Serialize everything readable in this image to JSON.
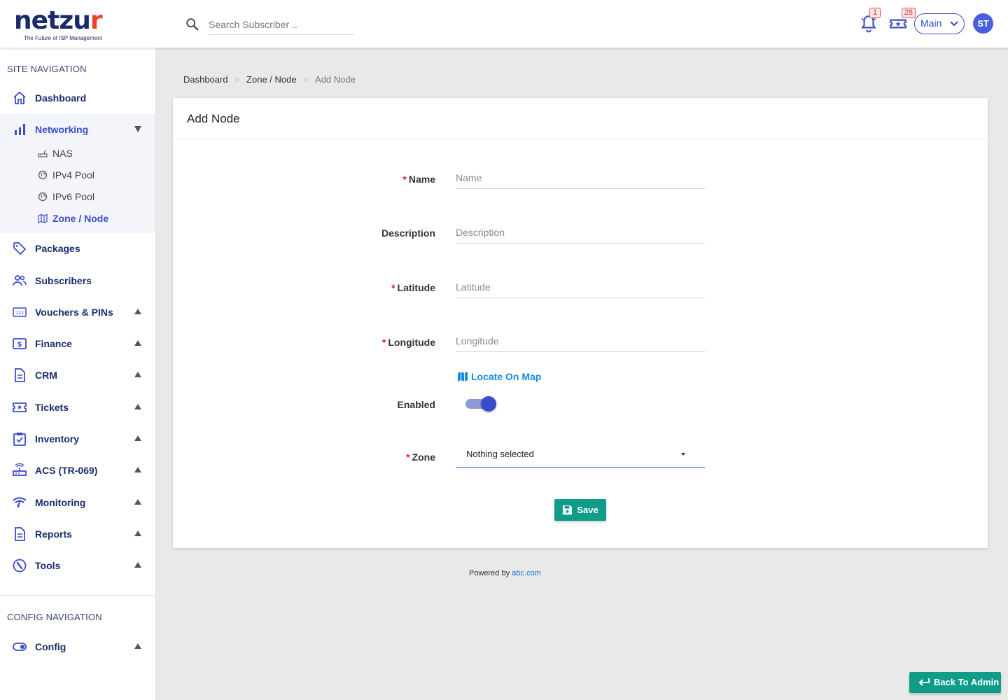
{
  "header": {
    "logo_text": "netzur",
    "logo_tagline": "The Future of ISP Management",
    "search_placeholder": "Search Subscriber ..",
    "notifications_count": "1",
    "tickets_count": "28",
    "account_label": "Main",
    "avatar_initials": "ST"
  },
  "sidebar": {
    "site_nav_title": "SITE NAVIGATION",
    "config_nav_title": "CONFIG NAVIGATION",
    "items": {
      "dashboard": "Dashboard",
      "networking": "Networking",
      "packages": "Packages",
      "subscribers": "Subscribers",
      "vouchers": "Vouchers & PINs",
      "finance": "Finance",
      "crm": "CRM",
      "tickets": "Tickets",
      "inventory": "Inventory",
      "acs": "ACS (TR-069)",
      "monitoring": "Monitoring",
      "reports": "Reports",
      "tools": "Tools",
      "config": "Config"
    },
    "networking_sub": {
      "nas": "NAS",
      "ipv4": "IPv4 Pool",
      "ipv6": "IPv6 Pool",
      "zone": "Zone / Node"
    }
  },
  "breadcrumb": {
    "dashboard": "Dashboard",
    "zone": "Zone / Node",
    "current": "Add Node",
    "separator": ">"
  },
  "form": {
    "title": "Add Node",
    "required_mark": "*",
    "name_label": "Name",
    "name_placeholder": "Name",
    "description_label": "Description",
    "description_placeholder": "Description",
    "latitude_label": "Latitude",
    "latitude_placeholder": "Latitude",
    "longitude_label": "Longitude",
    "longitude_placeholder": "Longitude",
    "locate_label": "Locate On Map",
    "enabled_label": "Enabled",
    "enabled": true,
    "zone_label": "Zone",
    "zone_value": "Nothing selected",
    "save_label": "Save"
  },
  "footer": {
    "powered_by": "Powered by",
    "link": "abc.com"
  },
  "back_to_admin": "Back To Admin",
  "colors": {
    "brand": "#1b2a6b",
    "accent": "#3b4cca",
    "primary_button": "#0f9d8a",
    "link": "#1a8ad8",
    "required": "#e02020"
  }
}
